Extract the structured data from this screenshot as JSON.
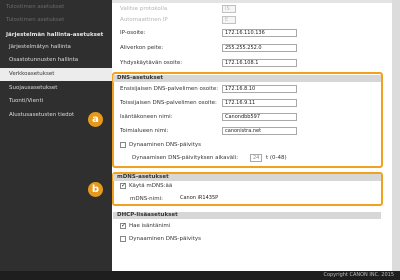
{
  "sidebar": {
    "ghost_items": [
      "Tulostimen asetukset",
      "Tulostimen asetukset"
    ],
    "section_title": "Järjestelmän hallinta-asetukset",
    "items": [
      {
        "label": "Järjestelmätyn hallinta",
        "active": false
      },
      {
        "label": "Osastotunnusten hallinta",
        "active": false
      },
      {
        "label": "Verkkoasetukset",
        "active": true
      },
      {
        "label": "Suojausasetukset",
        "active": false
      },
      {
        "label": "Tuonti/Vienti",
        "active": false
      },
      {
        "label": "Alustusasetusten tiedot",
        "active": false
      }
    ]
  },
  "ip": {
    "ghost1_label": "Valitse protokolla",
    "ghost1_value": "IS",
    "ghost2_label": "Automaattinen IP",
    "ghost2_value": "E",
    "address_label": "IP-osoite:",
    "address": "172.16.110.136",
    "mask_label": "Aliverkon peite:",
    "mask": "255.255.252.0",
    "gateway_label": "Yhdyskäytävän osoite:",
    "gateway": "172.16.108.1"
  },
  "dns": {
    "title": "DNS-asetukset",
    "primary_label": "Ensisijaisen DNS-palvelimen osoite:",
    "primary": "172.16.8.10",
    "secondary_label": "Toissijaisen DNS-palvelimen osoite:",
    "secondary": "172.16.9.11",
    "host_label": "Isäntäkoneen nimi:",
    "host": "Canondbb597",
    "domain_label": "Toimialueen nimi:",
    "domain": "canonistra.net",
    "dynamic_label": "Dynaaminen DNS-päivitys",
    "interval_label": "Dynaamisen DNS-päivityksen aikaväli:",
    "interval": "24",
    "interval_unit": "t (0-48)"
  },
  "mdns": {
    "title": "mDNS-asetukset",
    "use_label": "Käytä mDNS:ää",
    "use_checked": true,
    "name_label": "mDNS-nimi:",
    "name": "Canon iR1435P"
  },
  "dhcp": {
    "title": "DHCP-lisäasetukset",
    "host_label": "Hae isäntänimi",
    "host_checked": true,
    "dynamic_label": "Dynaaminen DNS-päivitys",
    "dynamic_checked": false
  },
  "badges": {
    "a": "a",
    "b": "b"
  },
  "footer": {
    "copyright": "Copyright CANON INC. 2015"
  },
  "colors": {
    "accent": "#f0a11e",
    "badge": "#e59a1c",
    "sidebar": "#2f2f2f"
  }
}
